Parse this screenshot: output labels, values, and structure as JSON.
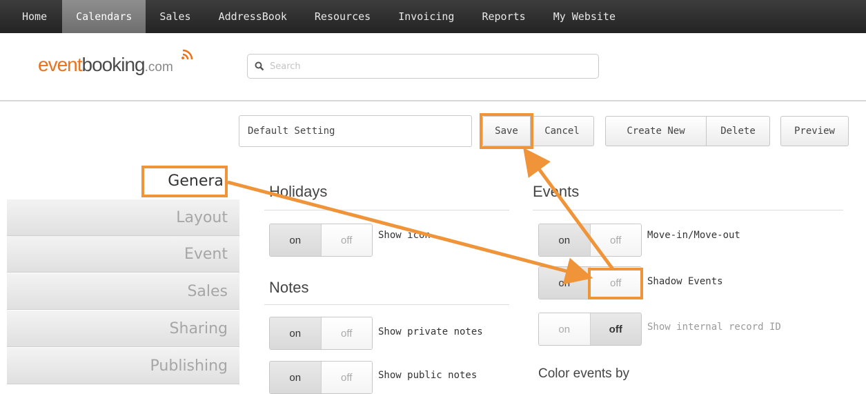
{
  "topnav": {
    "items": [
      {
        "label": "Home"
      },
      {
        "label": "Calendars"
      },
      {
        "label": "Sales"
      },
      {
        "label": "AddressBook"
      },
      {
        "label": "Resources"
      },
      {
        "label": "Invoicing"
      },
      {
        "label": "Reports"
      },
      {
        "label": "My Website"
      }
    ],
    "active": "Calendars"
  },
  "logo": {
    "part1": "event",
    "part2": "booking",
    "part3": ".com"
  },
  "search": {
    "placeholder": "Search"
  },
  "toolbar": {
    "setting_name": "Default Setting",
    "save_label": "Save",
    "cancel_label": "Cancel",
    "create_label": "Create New",
    "delete_label": "Delete",
    "preview_label": "Preview"
  },
  "sidebar": {
    "items": [
      {
        "label": "General"
      },
      {
        "label": "Layout"
      },
      {
        "label": "Event"
      },
      {
        "label": "Sales"
      },
      {
        "label": "Sharing"
      },
      {
        "label": "Publishing"
      }
    ],
    "active": "General"
  },
  "holidays": {
    "title": "Holidays",
    "show_icon": {
      "on": "on",
      "off": "off",
      "label": "Show icon",
      "value": "on"
    }
  },
  "notes": {
    "title": "Notes",
    "private": {
      "on": "on",
      "off": "off",
      "label": "Show private notes",
      "value": "on"
    },
    "public": {
      "on": "on",
      "off": "off",
      "label": "Show public notes",
      "value": "on"
    }
  },
  "events": {
    "title": "Events",
    "move": {
      "on": "on",
      "off": "off",
      "label": "Move-in/Move-out",
      "value": "on"
    },
    "shadow": {
      "on": "on",
      "off": "off",
      "label": "Shadow Events",
      "value": "on"
    },
    "internal": {
      "on": "on",
      "off": "off",
      "label": "Show internal record ID",
      "value": "off"
    },
    "color_by": "Color events by"
  },
  "colors": {
    "accent": "#f0943a",
    "logo_orange": "#e8731e",
    "nav_bg": "#2b2b2b"
  }
}
